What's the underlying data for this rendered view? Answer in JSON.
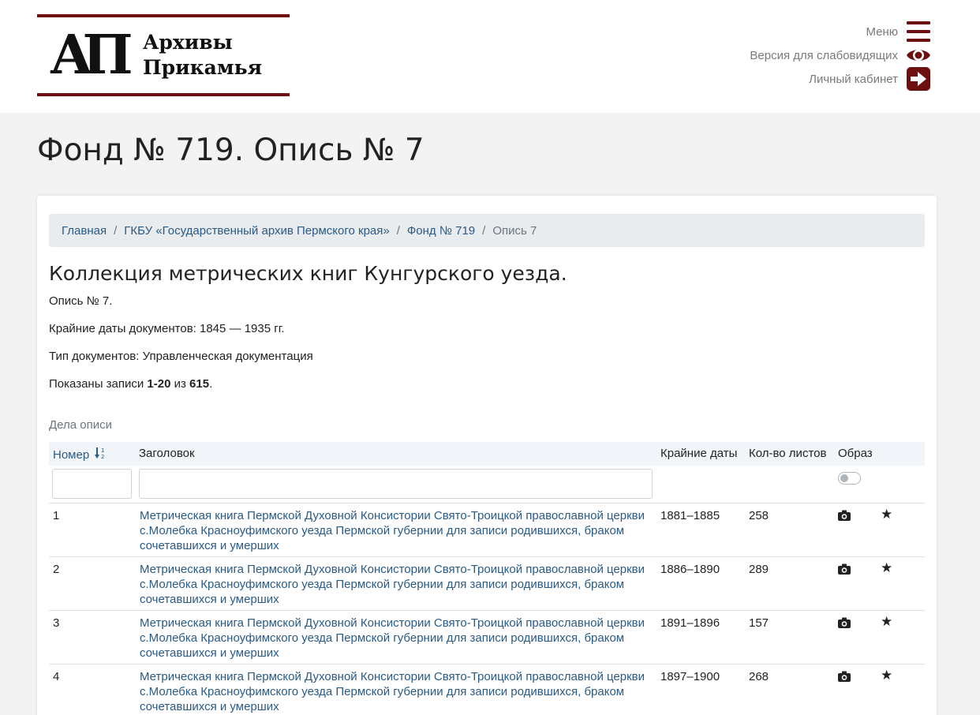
{
  "logo": {
    "mark": "АП",
    "line1": "Архивы",
    "line2": "Прикамья"
  },
  "usernav": {
    "menu": "Меню",
    "accessibility": "Версия для слабовидящих",
    "account": "Личный кабинет"
  },
  "page_title": "Фонд № 719. Опись № 7",
  "breadcrumb": {
    "home": "Главная",
    "archive": "ГКБУ «Государственный архив Пермского края»",
    "fond": "Фонд № 719",
    "current": "Опись 7",
    "separator": "/"
  },
  "inventory": {
    "heading": "Коллекция метрических книг Кунгурского уезда.",
    "opis": "Опись № 7.",
    "dates": "Крайние даты документов: 1845 — 1935 гг.",
    "doc_type": "Тип документов: Управленческая документация",
    "shown_prefix": "Показаны записи ",
    "shown_range": "1-20",
    "shown_mid": " из ",
    "shown_total": "615",
    "shown_suffix": "."
  },
  "table": {
    "caption": "Дела описи",
    "headers": {
      "number": "Номер",
      "title": "Заголовок",
      "dates": "Крайние даты",
      "sheets": "Кол-во листов",
      "image": "Образ"
    },
    "rows": [
      {
        "number": "1",
        "title": "Метрическая книга Пермской Духовной Консистории Свято-Троицкой православной церкви с.Молебка Красноуфимского уезда Пермской губернии для записи родившихся, браком сочетавшихся и умерших",
        "dates": "1881–1885",
        "sheets": "258"
      },
      {
        "number": "2",
        "title": "Метрическая книга Пермской Духовной Консистории Свято-Троицкой православной церкви с.Молебка Красноуфимского уезда Пермской губернии для записи родившихся, браком сочетавшихся и умерших",
        "dates": "1886–1890",
        "sheets": "289"
      },
      {
        "number": "3",
        "title": "Метрическая книга Пермской Духовной Консистории Свято-Троицкой православной церкви с.Молебка Красноуфимского уезда Пермской губернии для записи родившихся, браком сочетавшихся и умерших",
        "dates": "1891–1896",
        "sheets": "157"
      },
      {
        "number": "4",
        "title": "Метрическая книга Пермской Духовной Консистории Свято-Троицкой православной церкви с.Молебка Красноуфимского уезда Пермской губернии для записи родившихся, браком сочетавшихся и умерших",
        "dates": "1897–1900",
        "sheets": "268"
      }
    ]
  },
  "icons": {
    "menu": "hamburger-icon",
    "accessibility": "eye-icon",
    "account": "sign-in-icon",
    "sort": "sort-numeric-icon",
    "image": "camera-icon",
    "favorite": "star-icon"
  },
  "colors": {
    "brand": "#6b0f0f",
    "link": "#2a5a86",
    "background": "#f3f3f3"
  }
}
